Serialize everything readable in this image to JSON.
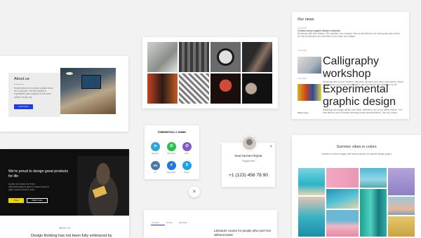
{
  "about": {
    "title": "About us",
    "desc": "Serait meium in et dolore orytand nemo de in dolorum. Fuit Nisi dipterum cupiditatem atero siquae ut loris sens ostiles et lestu ais.",
    "button": "Learn more"
  },
  "hero": {
    "title": "We're proud to design great products for life",
    "desc": "Doelia coll sinder dis Porte deturinesemperet quae lo tersum blant te quae et ipso turnat in cras.",
    "btn_primary": "Order",
    "btn_secondary": "Watch video",
    "section_label": "ABOUT US",
    "subtitle": "Design thinking has not been fully embraced by"
  },
  "contact": {
    "title": "Свяжитесь с нами",
    "items": [
      {
        "label": "Telegram",
        "icon": "telegram-icon",
        "color": "#2ea6da",
        "glyph": "➤"
      },
      {
        "label": "WhatsApp",
        "icon": "whatsapp-icon",
        "color": "#27c04b",
        "glyph": "✆"
      },
      {
        "label": "Viber",
        "icon": "viber-icon",
        "color": "#7c5cc4",
        "glyph": "✆"
      },
      {
        "label": "VK",
        "icon": "vk-icon",
        "color": "#4a76a8",
        "glyph": "VK"
      },
      {
        "label": "Messenger",
        "icon": "messenger-icon",
        "color": "#1877f2",
        "glyph": "⚡"
      },
      {
        "label": "Skype",
        "icon": "skype-icon",
        "color": "#1aa3e8",
        "glyph": "S"
      }
    ],
    "close": "×"
  },
  "manager": {
    "name": "Константин Перов",
    "role": "Поддержка",
    "phone": "+1 (123) 456 78 90",
    "close": "×"
  },
  "tabs": {
    "items": [
      "Tutorials",
      "Guides",
      "Bestseller"
    ],
    "text": "Literature course for people who can't live without books"
  },
  "news": {
    "title": "Our news",
    "items": [
      {
        "date": "10.01.2020",
        "title": "Creative song in graphic design companies",
        "text": "Workshop with Irina Nasipo. We invented our company. Here is the fullest of our main goals and events. He has formed five core members of our team and budget."
      },
      {
        "date": "11.01.2020",
        "title": "Calligraphy workshop",
        "text": "Workshop with a pros: brushes, sila pens, dip pens, and other instruments. Sarah will introduce you all great materials to get you started with lettering. For all levels."
      },
      {
        "date": "12.01.2020",
        "title": "Experimental graphic design",
        "text": "Workshop will design details Like Rank, rethinkers one of our offline picture. The new task for you to function learning visual communication. Join our course."
      }
    ],
    "more": "Show more →"
  },
  "summer": {
    "title": "Summer vibes in colors",
    "subtitle": "Introduce colorful images with vibrant layouts on special design project"
  }
}
